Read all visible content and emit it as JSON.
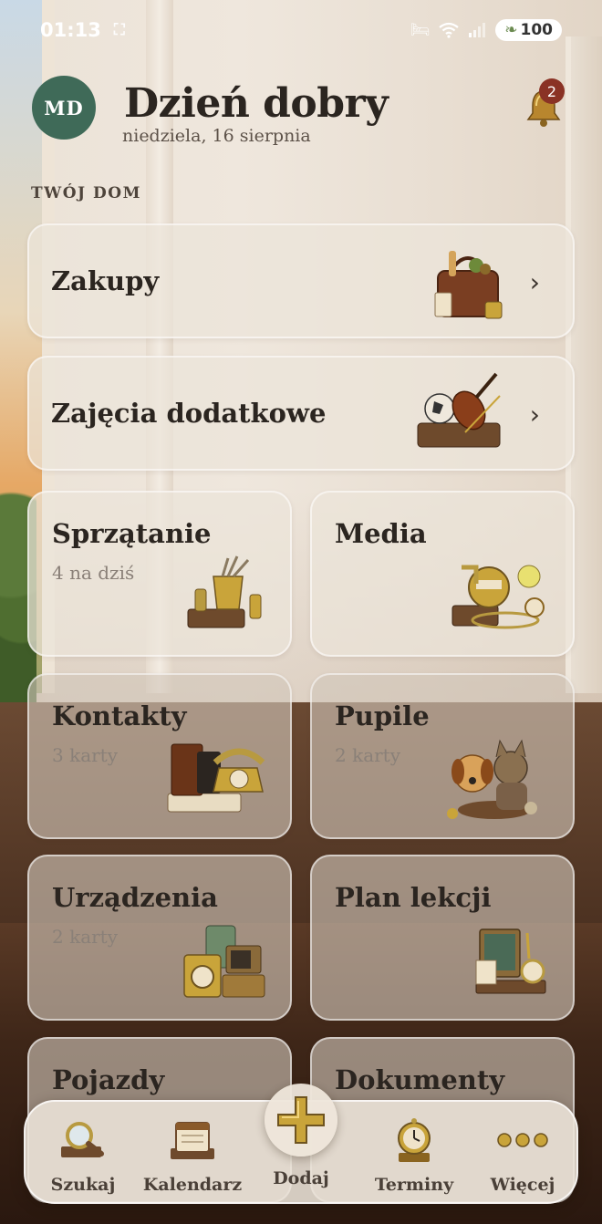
{
  "status_bar": {
    "time": "01:13",
    "battery": "100"
  },
  "header": {
    "avatar_initials": "MD",
    "greeting": "Dzień dobry",
    "date": "niedziela, 16 sierpnia",
    "notifications_count": "2"
  },
  "section": {
    "title": "TWÓJ DOM"
  },
  "cards": {
    "zakupy": {
      "title": "Zakupy",
      "icon": "shopping-bag-icon"
    },
    "zajecia": {
      "title": "Zajęcia dodatkowe",
      "icon": "violin-ball-icon"
    },
    "sprzatanie": {
      "title": "Sprzątanie",
      "subtitle": "4 na dziś",
      "icon": "cleaning-bucket-icon"
    },
    "media": {
      "title": "Media",
      "icon": "utility-meter-icon"
    },
    "kontakty": {
      "title": "Kontakty",
      "subtitle": "3 karty",
      "icon": "telephone-icon"
    },
    "pupile": {
      "title": "Pupile",
      "subtitle": "2 karty",
      "icon": "pets-icon"
    },
    "urzadzenia": {
      "title": "Urządzenia",
      "subtitle": "2 karty",
      "icon": "appliances-icon"
    },
    "plan_lekcji": {
      "title": "Plan lekcji",
      "icon": "chalkboard-icon"
    },
    "pojazdy": {
      "title": "Pojazdy"
    },
    "dokumenty": {
      "title": "Dokumenty"
    }
  },
  "nav": {
    "search": "Szukaj",
    "calendar": "Kalendarz",
    "add": "Dodaj",
    "appointments": "Terminy",
    "more": "Więcej"
  },
  "colors": {
    "avatar_bg": "#3f6a58",
    "badge_bg": "#8a3225",
    "gold": "#c9a43a"
  }
}
